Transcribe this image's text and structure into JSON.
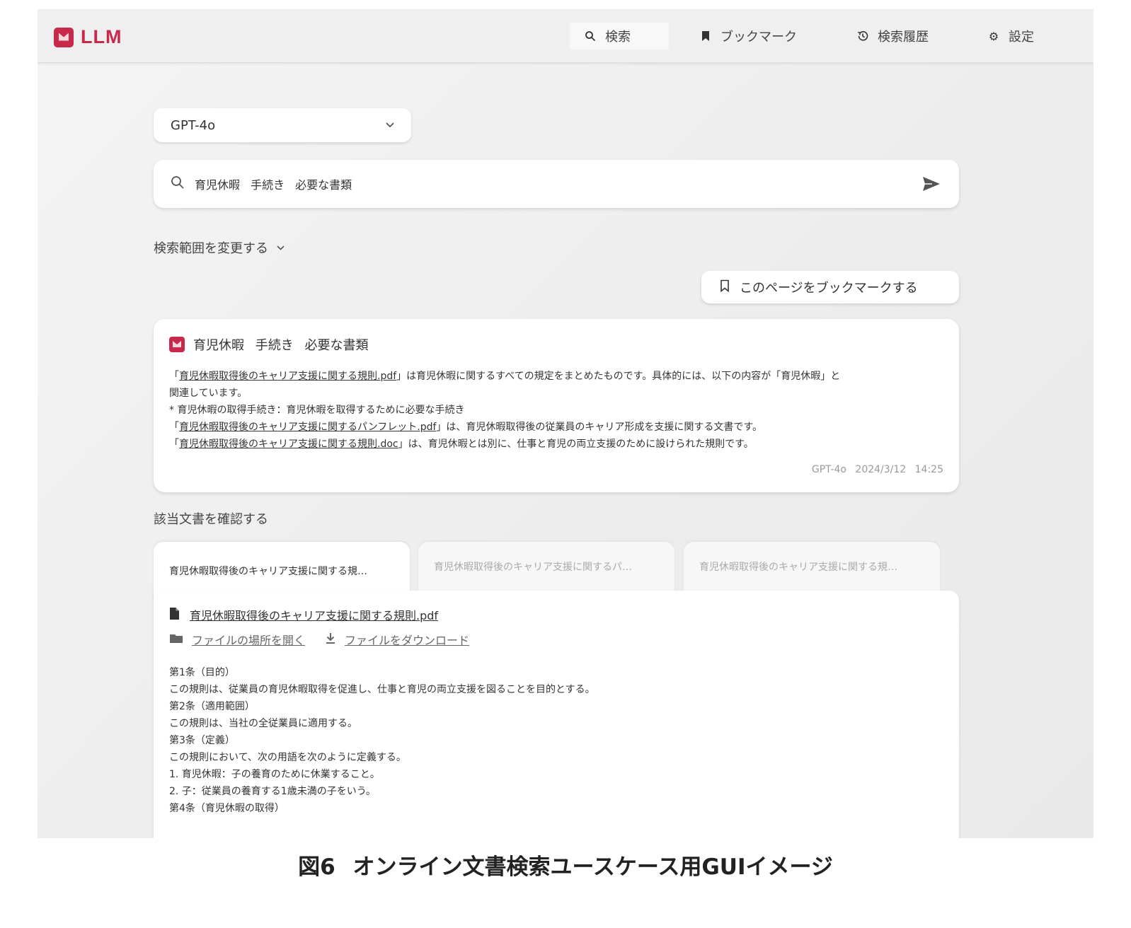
{
  "header": {
    "logo_text": "LLM",
    "brand_color": "#c8294a",
    "nav": [
      {
        "label": "検索",
        "icon": "search-icon",
        "active": true
      },
      {
        "label": "ブックマーク",
        "icon": "bookmark-icon",
        "active": false
      },
      {
        "label": "検索履歴",
        "icon": "history-icon",
        "active": false
      },
      {
        "label": "設定",
        "icon": "gear-icon",
        "active": false
      }
    ]
  },
  "model_select": {
    "value": "GPT-4o"
  },
  "search": {
    "query": "育児休暇 手続き 必要な書類"
  },
  "scope_toggle": {
    "label": "検索範囲を変更する"
  },
  "bookmark_page": {
    "label": "このページをブックマークする"
  },
  "answer": {
    "title": "育児休暇 手続き 必要な書類",
    "lines": [
      {
        "pre": "「",
        "link": "育児休暇取得後のキャリア支援に関する規則.pdf",
        "post": "」は育児休暇に関するすべての規定をまとめたものです。具体的には、以下の内容が「育児休暇」と"
      },
      {
        "pre": "関連しています。",
        "link": "",
        "post": ""
      },
      {
        "pre": "* 育児休暇の取得手続き：育児休暇を取得するために必要な手続き",
        "link": "",
        "post": ""
      },
      {
        "pre": "「",
        "link": "育児休暇取得後のキャリア支援に関するパンフレット.pdf",
        "post": "」は、育児休暇取得後の従業員のキャリア形成を支援に関する文書です。"
      },
      {
        "pre": "「",
        "link": "育児休暇取得後のキャリア支援に関する規則.doc",
        "post": "」は、育児休暇とは別に、仕事と育児の両立支援のために設けられた規則です。"
      }
    ],
    "meta": "GPT-4o 2024/3/12 14:25"
  },
  "documents": {
    "heading": "該当文書を確認する",
    "tabs": [
      "育児休暇取得後のキャリア支援に関する規…",
      "育児休暇取得後のキャリア支援に関するパ…",
      "育児休暇取得後のキャリア支援に関する規…"
    ],
    "file_name": "育児休暇取得後のキャリア支援に関する規則.pdf",
    "open_location": "ファイルの場所を開く",
    "download": "ファイルをダウンロード",
    "content": [
      "第1条（目的）",
      "この規則は、従業員の育児休暇取得を促進し、仕事と育児の両立支援を図ることを目的とする。",
      "第2条（適用範囲）",
      "この規則は、当社の全従業員に適用する。",
      "第3条（定義）",
      "この規則において、次の用語を次のように定義する。",
      "1. 育児休暇：子の養育のために休業すること。",
      "2. 子：従業員の養育する1歳未満の子をいう。",
      "第4条（育児休暇の取得）"
    ]
  },
  "caption": "図6 オンライン文書検索ユースケース用GUIイメージ"
}
